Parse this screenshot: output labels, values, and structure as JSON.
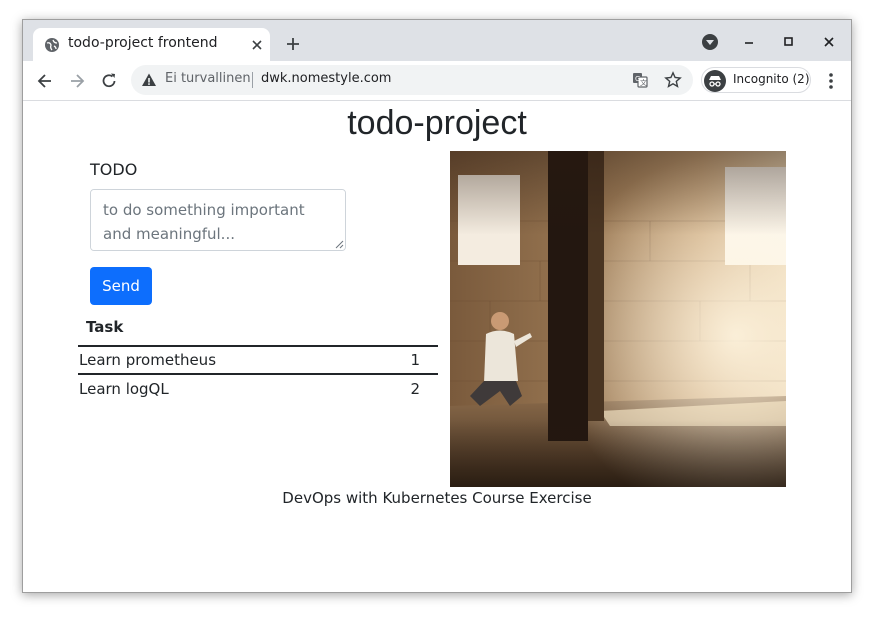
{
  "browser": {
    "tab": {
      "title": "todo-project frontend"
    },
    "omnibox": {
      "security_text": "Ei turvallinen",
      "url": "dwk.nomestyle.com"
    },
    "incognito_label": "Incognito (2)"
  },
  "page": {
    "title": "todo-project",
    "form": {
      "label": "TODO",
      "placeholder": "to do something important and meaningful...",
      "value": "",
      "send_label": "Send"
    },
    "table": {
      "header": "Task",
      "rows": [
        {
          "task": "Learn prometheus",
          "id": "1"
        },
        {
          "task": "Learn logQL",
          "id": "2"
        }
      ]
    },
    "footer": "DevOps with Kubernetes Course Exercise"
  },
  "colors": {
    "accent": "#0d6efd",
    "tabstrip": "#dee1e6",
    "text": "#212529"
  },
  "icons": [
    "globe-icon",
    "close-icon",
    "plus-icon",
    "tab-search-icon",
    "minimize-icon",
    "maximize-icon",
    "back-icon",
    "forward-icon",
    "reload-icon",
    "warning-icon",
    "translate-icon",
    "star-icon",
    "incognito-icon",
    "more-icon"
  ]
}
